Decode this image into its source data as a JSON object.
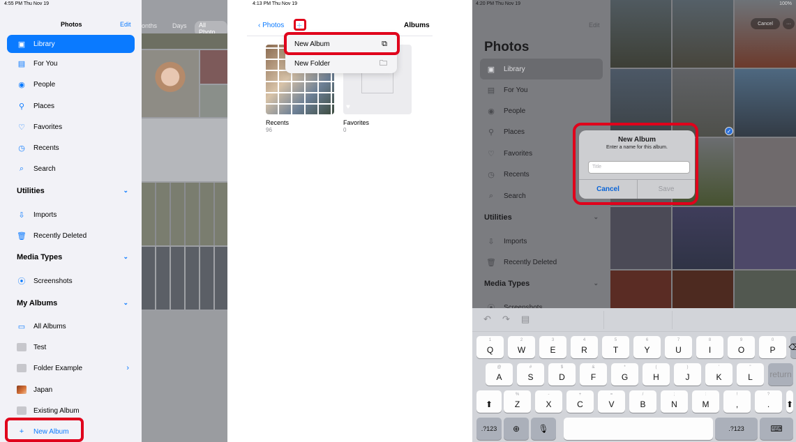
{
  "panel1": {
    "status_time": "4:55 PM  Thu Nov 19",
    "title": "Photos",
    "edit": "Edit",
    "items": [
      {
        "label": "Library",
        "icon": "library-icon"
      },
      {
        "label": "For You",
        "icon": "for-you-icon"
      },
      {
        "label": "People",
        "icon": "people-icon"
      },
      {
        "label": "Places",
        "icon": "places-icon"
      },
      {
        "label": "Favorites",
        "icon": "heart-icon"
      },
      {
        "label": "Recents",
        "icon": "clock-icon"
      },
      {
        "label": "Search",
        "icon": "search-icon"
      }
    ],
    "utilities": {
      "heading": "Utilities",
      "items": [
        "Imports",
        "Recently Deleted"
      ]
    },
    "media_types": {
      "heading": "Media Types",
      "items": [
        "Screenshots"
      ]
    },
    "my_albums": {
      "heading": "My Albums",
      "items": [
        "All Albums",
        "Test",
        "Folder Example",
        "Japan",
        "Existing Album",
        "New Album"
      ]
    },
    "tabs": {
      "months": "onths",
      "days": "Days",
      "all": "All Photo"
    }
  },
  "panel2": {
    "status_time": "4:13 PM  Thu Nov 19",
    "back": "Photos",
    "plus": "+",
    "title": "Albums",
    "menu": {
      "new_album": "New Album",
      "new_folder": "New Folder"
    },
    "albums": [
      {
        "name": "Recents",
        "count": "96"
      },
      {
        "name": "Favorites",
        "count": "0"
      }
    ]
  },
  "panel3": {
    "status_time": "4:20 PM  Thu Nov 19",
    "status_right": "100%",
    "edit": "Edit",
    "title": "Photos",
    "items": [
      "Library",
      "For You",
      "People",
      "Places",
      "Favorites",
      "Recents",
      "Search"
    ],
    "utilities": {
      "heading": "Utilities",
      "items": [
        "Imports",
        "Recently Deleted"
      ]
    },
    "media_types": {
      "heading": "Media Types",
      "items": [
        "Screenshots"
      ]
    },
    "cancel_top": "Cancel",
    "more_top": "···",
    "dialog": {
      "title": "New Album",
      "subtitle": "Enter a name for this album.",
      "placeholder": "Title",
      "cancel": "Cancel",
      "save": "Save"
    },
    "keyboard": {
      "row1": [
        [
          "1",
          "Q"
        ],
        [
          "2",
          "W"
        ],
        [
          "3",
          "E"
        ],
        [
          "4",
          "R"
        ],
        [
          "5",
          "T"
        ],
        [
          "6",
          "Y"
        ],
        [
          "7",
          "U"
        ],
        [
          "8",
          "I"
        ],
        [
          "9",
          "O"
        ],
        [
          "0",
          "P"
        ]
      ],
      "row2": [
        [
          "@",
          "A"
        ],
        [
          "#",
          "S"
        ],
        [
          "$",
          "D"
        ],
        [
          "&",
          "F"
        ],
        [
          "*",
          "G"
        ],
        [
          "(",
          "H"
        ],
        [
          ")",
          "J"
        ],
        [
          "'",
          "K"
        ],
        [
          "\"",
          "L"
        ]
      ],
      "row3": [
        [
          "%",
          "Z"
        ],
        [
          "-",
          "X"
        ],
        [
          "+",
          "C"
        ],
        [
          "=",
          "V"
        ],
        [
          "/",
          "B"
        ],
        [
          ";",
          "N"
        ],
        [
          ":",
          "M"
        ],
        [
          "!",
          ","
        ],
        [
          "?",
          "."
        ]
      ],
      "return": "return",
      "numkey": ".?123"
    }
  },
  "colors": {
    "accent": "#0a7aff",
    "highlight": "#e0001b"
  }
}
